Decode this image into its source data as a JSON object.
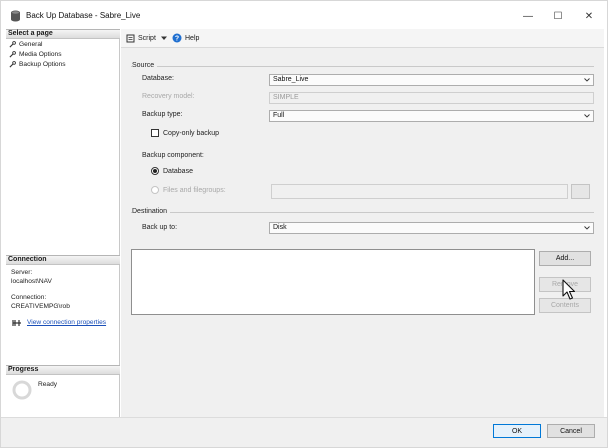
{
  "window": {
    "title": "Back Up Database - Sabre_Live",
    "controls": {
      "minimize": "—",
      "maximize": "☐",
      "close": "✕"
    }
  },
  "left_pane": {
    "select_page_header": "Select a page",
    "pages": [
      {
        "label": "General"
      },
      {
        "label": "Media Options"
      },
      {
        "label": "Backup Options"
      }
    ],
    "connection_header": "Connection",
    "server_label": "Server:",
    "server_value": "localhost\\NAV",
    "connection_label": "Connection:",
    "connection_value": "CREATIVEMPG\\rob",
    "view_connection_link": "View connection properties",
    "progress_header": "Progress",
    "progress_status": "Ready"
  },
  "toolbar": {
    "script_label": "Script",
    "help_label": "Help"
  },
  "source": {
    "section_label": "Source",
    "database_label": "Database:",
    "database_value": "Sabre_Live",
    "recovery_model_label": "Recovery model:",
    "recovery_model_value": "SIMPLE",
    "backup_type_label": "Backup type:",
    "backup_type_value": "Full",
    "copy_only_label": "Copy-only backup",
    "backup_component_label": "Backup component:",
    "component_database_label": "Database",
    "component_files_label": "Files and filegroups:"
  },
  "destination": {
    "section_label": "Destination",
    "backup_to_label": "Back up to:",
    "backup_to_value": "Disk",
    "add_label": "Add...",
    "remove_label": "Remove",
    "contents_label": "Contents"
  },
  "footer": {
    "ok_label": "OK",
    "cancel_label": "Cancel"
  },
  "colors": {
    "accent": "#0078d7",
    "link": "#1a4fb8",
    "pane_bg": "#f0f0f0"
  }
}
